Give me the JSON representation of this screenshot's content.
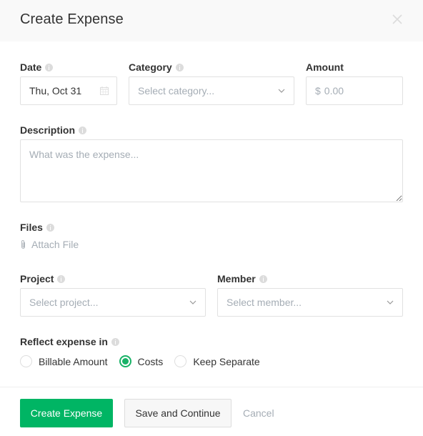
{
  "header": {
    "title": "Create Expense",
    "close_icon": "close-icon"
  },
  "form": {
    "date": {
      "label": "Date",
      "value": "Thu, Oct 31",
      "icon": "calendar-icon"
    },
    "category": {
      "label": "Category",
      "placeholder": "Select category..."
    },
    "amount": {
      "label": "Amount",
      "currency": "$",
      "placeholder": "0.00"
    },
    "description": {
      "label": "Description",
      "placeholder": "What was the expense..."
    },
    "files": {
      "label": "Files",
      "attach_label": "Attach File",
      "icon": "paperclip-icon"
    },
    "project": {
      "label": "Project",
      "placeholder": "Select project..."
    },
    "member": {
      "label": "Member",
      "placeholder": "Select member..."
    },
    "reflect": {
      "label": "Reflect expense in",
      "options": [
        {
          "label": "Billable Amount",
          "checked": false
        },
        {
          "label": "Costs",
          "checked": true
        },
        {
          "label": "Keep Separate",
          "checked": false
        }
      ]
    }
  },
  "footer": {
    "create_label": "Create Expense",
    "save_continue_label": "Save and Continue",
    "cancel_label": "Cancel"
  },
  "colors": {
    "accent": "#00b564",
    "radio_checked": "#19b267",
    "placeholder": "#a5adb5",
    "border": "#e1e1e1",
    "header_bg": "#f9f9f9"
  }
}
